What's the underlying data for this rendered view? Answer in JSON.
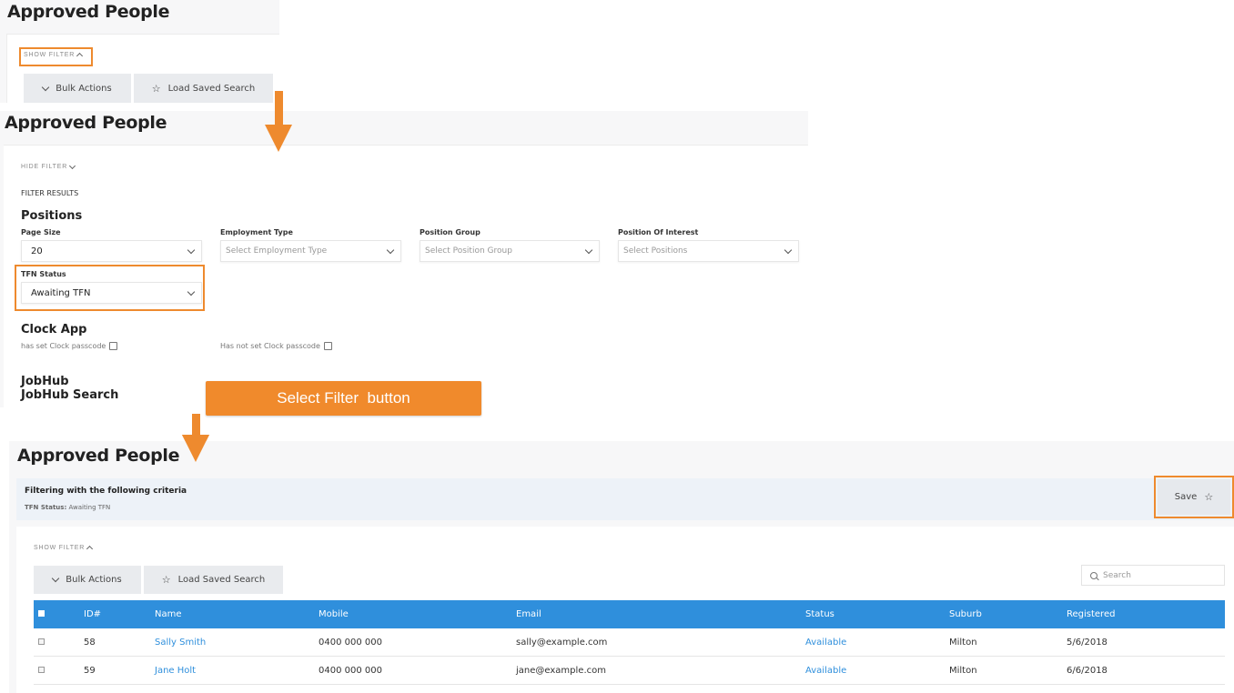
{
  "page_title": "Approved People",
  "panel1": {
    "show_filter": "SHOW FILTER",
    "bulk_actions": "Bulk Actions",
    "load_saved_search": "Load Saved Search"
  },
  "panel2": {
    "hide_filter": "HIDE FILTER",
    "filter_results": "FILTER RESULTS",
    "positions_heading": "Positions",
    "page_size_label": "Page Size",
    "page_size_value": "20",
    "employment_type_label": "Employment Type",
    "employment_type_placeholder": "Select Employment Type",
    "position_group_label": "Position Group",
    "position_group_placeholder": "Select Position Group",
    "position_interest_label": "Position Of Interest",
    "position_interest_placeholder": "Select Positions",
    "tfn_status_label": "TFN Status",
    "tfn_status_value": "Awaiting TFN",
    "clock_app_heading": "Clock App",
    "has_set_passcode": "has set Clock passcode",
    "has_not_set_passcode": "Has not set Clock passcode",
    "jobhub_heading": "JobHub",
    "jobhub_search_heading": "JobHub Search"
  },
  "callout": "Select Filter  button",
  "panel3": {
    "criteria_title": "Filtering with the following criteria",
    "criteria_key": "TFN Status:",
    "criteria_value": " Awaiting TFN",
    "save_label": "Save",
    "show_filter": "SHOW FILTER",
    "bulk_actions": "Bulk Actions",
    "load_saved_search": "Load Saved Search",
    "search_placeholder": "Search",
    "table": {
      "columns": [
        "ID#",
        "Name",
        "Mobile",
        "Email",
        "Status",
        "Suburb",
        "Registered"
      ],
      "rows": [
        {
          "id": "58",
          "name": "Sally Smith",
          "mobile": "0400 000 000",
          "email": "sally@example.com",
          "status": "Available",
          "suburb": "Milton",
          "registered": "5/6/2018"
        },
        {
          "id": "59",
          "name": "Jane Holt",
          "mobile": "0400 000 000",
          "email": "jane@example.com",
          "status": "Available",
          "suburb": "Milton",
          "registered": "6/6/2018"
        }
      ]
    }
  },
  "colors": {
    "annotation_orange": "#ee8a2e",
    "table_header_blue": "#2f8fdc",
    "link_blue": "#2f8fdc",
    "criteria_bg": "#edf2f8"
  }
}
